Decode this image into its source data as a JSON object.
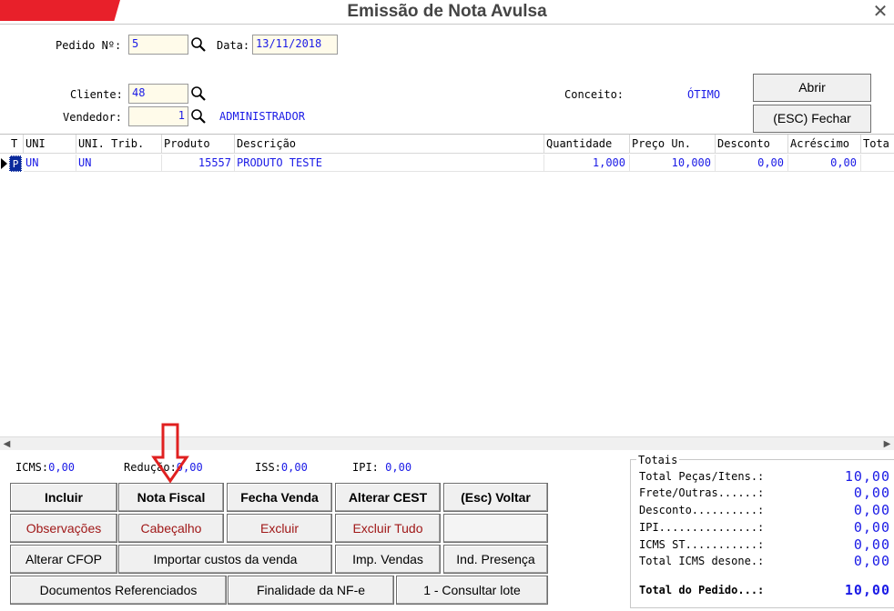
{
  "window": {
    "title": "Emissão de Nota Avulsa",
    "close_glyph": "✕"
  },
  "header": {
    "pedido_label": "Pedido Nº:",
    "pedido_value": "5",
    "data_label": "Data:",
    "data_value": "13/11/2018",
    "cliente_label": "Cliente:",
    "cliente_value": "48",
    "vendedor_label": "Vendedor:",
    "vendedor_value": "1",
    "vendedor_name": "ADMINISTRADOR",
    "conceito_label": "Conceito:",
    "conceito_value": "ÓTIMO",
    "abrir_label": "Abrir",
    "fechar_label": "(ESC) Fechar"
  },
  "grid": {
    "columns": [
      "T",
      "UNI",
      "UNI. Trib.",
      "Produto",
      "Descrição",
      "Quantidade",
      "Preço Un.",
      "Desconto",
      "Acréscimo",
      "Tota"
    ],
    "rows": [
      {
        "t": "P",
        "uni": "UN",
        "uni_trib": "UN",
        "produto": "15557",
        "descricao": "PRODUTO TESTE",
        "quantidade": "1,000",
        "preco_un": "10,000",
        "desconto": "0,00",
        "acrescimo": "0,00",
        "total": ""
      }
    ]
  },
  "taxes": {
    "icms_label": "ICMS:",
    "icms_value": "0,00",
    "reducao_label": "Redução:",
    "reducao_value": "0,00",
    "iss_label": "ISS:",
    "iss_value": "0,00",
    "ipi_label": "IPI:",
    "ipi_value": "0,00"
  },
  "buttons": {
    "incluir": "Incluir",
    "nota_fiscal": "Nota Fiscal",
    "fecha_venda": "Fecha Venda",
    "alterar_cest": "Alterar CEST",
    "voltar": "(Esc) Voltar",
    "observacoes": "Observações",
    "cabecalho": "Cabeçalho",
    "excluir": "Excluir",
    "excluir_tudo": "Excluir Tudo",
    "alterar_cfop": "Alterar CFOP",
    "importar_custos": "Importar custos da venda",
    "imp_vendas": "Imp. Vendas",
    "ind_presenca": "Ind. Presença",
    "documentos": "Documentos Referenciados",
    "finalidade": "Finalidade da NF-e",
    "consultar_lote": "1 - Consultar lote"
  },
  "totals": {
    "title": "Totais",
    "items": [
      {
        "label": "Total Peças/Itens.:",
        "value": "10,00"
      },
      {
        "label": "Frete/Outras......:",
        "value": "0,00"
      },
      {
        "label": "Desconto..........:",
        "value": "0,00"
      },
      {
        "label": "IPI...............:",
        "value": "0,00"
      },
      {
        "label": "ICMS ST...........:",
        "value": "0,00"
      },
      {
        "label": "Total ICMS desone.:",
        "value": "0,00"
      }
    ],
    "total_label": "Total do Pedido...:",
    "total_value": "10,00"
  },
  "colors": {
    "accent": "#e8202a",
    "value_blue": "#1a1ae6",
    "annotation_red": "#e02020"
  }
}
